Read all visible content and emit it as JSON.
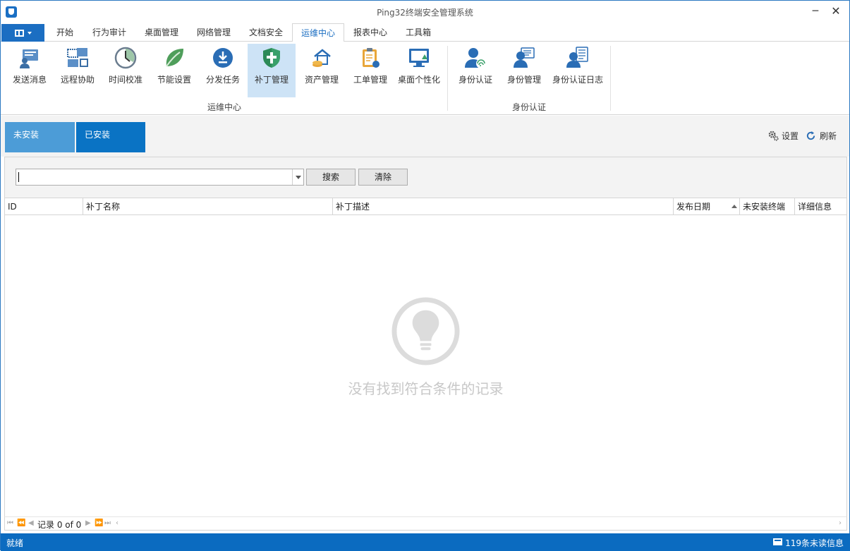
{
  "window": {
    "title": "Ping32终端安全管理系统",
    "minimize": "─",
    "maximize": "☐",
    "close": "✕"
  },
  "ribbon_tabs": [
    "开始",
    "行为审计",
    "桌面管理",
    "网络管理",
    "文档安全",
    "运维中心",
    "报表中心",
    "工具箱"
  ],
  "active_tab": "运维中心",
  "ribbon": {
    "buttons": [
      {
        "label": "发送消息",
        "icon": "send-message-icon"
      },
      {
        "label": "远程协助",
        "icon": "remote-assist-icon"
      },
      {
        "label": "时间校准",
        "icon": "clock-icon"
      },
      {
        "label": "节能设置",
        "icon": "leaf-icon"
      },
      {
        "label": "分发任务",
        "icon": "download-icon"
      },
      {
        "label": "补丁管理",
        "icon": "shield-icon",
        "selected": true
      },
      {
        "label": "资产管理",
        "icon": "asset-icon"
      },
      {
        "label": "工单管理",
        "icon": "clipboard-icon"
      },
      {
        "label": "桌面个性化",
        "icon": "monitor-icon"
      },
      {
        "label": "身份认证",
        "icon": "fingerprint-user-icon"
      },
      {
        "label": "身份管理",
        "icon": "user-card-icon"
      },
      {
        "label": "身份认证日志",
        "icon": "user-log-icon"
      }
    ],
    "groups": [
      "运维中心",
      "身份认证"
    ]
  },
  "subtabs": [
    "未安装",
    "已安装"
  ],
  "toolbar": {
    "settings": "设置",
    "refresh": "刷新"
  },
  "search": {
    "value": "",
    "search_button": "搜索",
    "clear_button": "清除"
  },
  "table": {
    "columns": [
      "ID",
      "补丁名称",
      "补丁描述",
      "发布日期",
      "未安装终端",
      "详细信息"
    ],
    "rows": []
  },
  "empty_message": "没有找到符合条件的记录",
  "navigator": {
    "record_text": "记录 0 of 0"
  },
  "status": {
    "left": "就绪",
    "right": "119条未读信息"
  }
}
